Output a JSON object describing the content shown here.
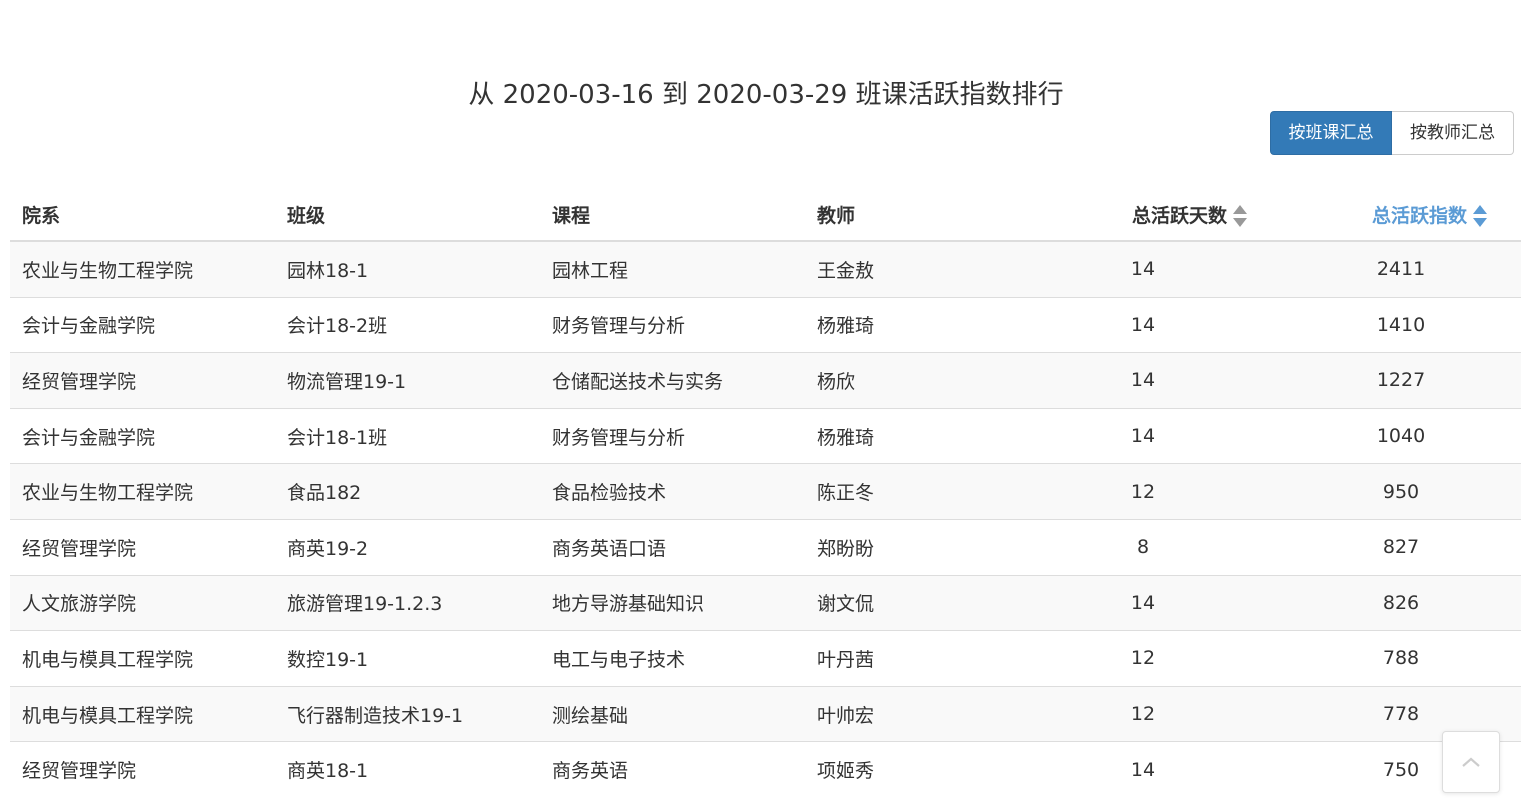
{
  "title": "从 2020-03-16 到 2020-03-29 班课活跃指数排行",
  "buttons": {
    "by_class": "按班课汇总",
    "by_teacher": "按教师汇总"
  },
  "table": {
    "headers": {
      "dept": "院系",
      "class": "班级",
      "course": "课程",
      "teacher": "教师",
      "days": "总活跃天数",
      "index": "总活跃指数"
    },
    "sorted_column": "index",
    "rows": [
      {
        "dept": "农业与生物工程学院",
        "class": "园林18-1",
        "course": "园林工程",
        "teacher": "王金敖",
        "days": "14",
        "index": "2411"
      },
      {
        "dept": "会计与金融学院",
        "class": "会计18-2班",
        "course": "财务管理与分析",
        "teacher": "杨雅琦",
        "days": "14",
        "index": "1410"
      },
      {
        "dept": "经贸管理学院",
        "class": "物流管理19-1",
        "course": "仓储配送技术与实务",
        "teacher": "杨欣",
        "days": "14",
        "index": "1227"
      },
      {
        "dept": "会计与金融学院",
        "class": "会计18-1班",
        "course": "财务管理与分析",
        "teacher": "杨雅琦",
        "days": "14",
        "index": "1040"
      },
      {
        "dept": "农业与生物工程学院",
        "class": "食品182",
        "course": "食品检验技术",
        "teacher": "陈正冬",
        "days": "12",
        "index": "950"
      },
      {
        "dept": "经贸管理学院",
        "class": "商英19-2",
        "course": "商务英语口语",
        "teacher": "郑盼盼",
        "days": "8",
        "index": "827"
      },
      {
        "dept": "人文旅游学院",
        "class": "旅游管理19-1.2.3",
        "course": "地方导游基础知识",
        "teacher": "谢文侃",
        "days": "14",
        "index": "826"
      },
      {
        "dept": "机电与模具工程学院",
        "class": "数控19-1",
        "course": "电工与电子技术",
        "teacher": "叶丹茜",
        "days": "12",
        "index": "788"
      },
      {
        "dept": "机电与模具工程学院",
        "class": "飞行器制造技术19-1",
        "course": "测绘基础",
        "teacher": "叶帅宏",
        "days": "12",
        "index": "778"
      },
      {
        "dept": "经贸管理学院",
        "class": "商英18-1",
        "course": "商务英语",
        "teacher": "项姬秀",
        "days": "14",
        "index": "750"
      }
    ]
  },
  "icons": {
    "sort": "sort-icon",
    "back_to_top": "chevron-up-icon"
  },
  "colors": {
    "primary": "#337ab7",
    "sorted_header": "#5b9bd5"
  }
}
